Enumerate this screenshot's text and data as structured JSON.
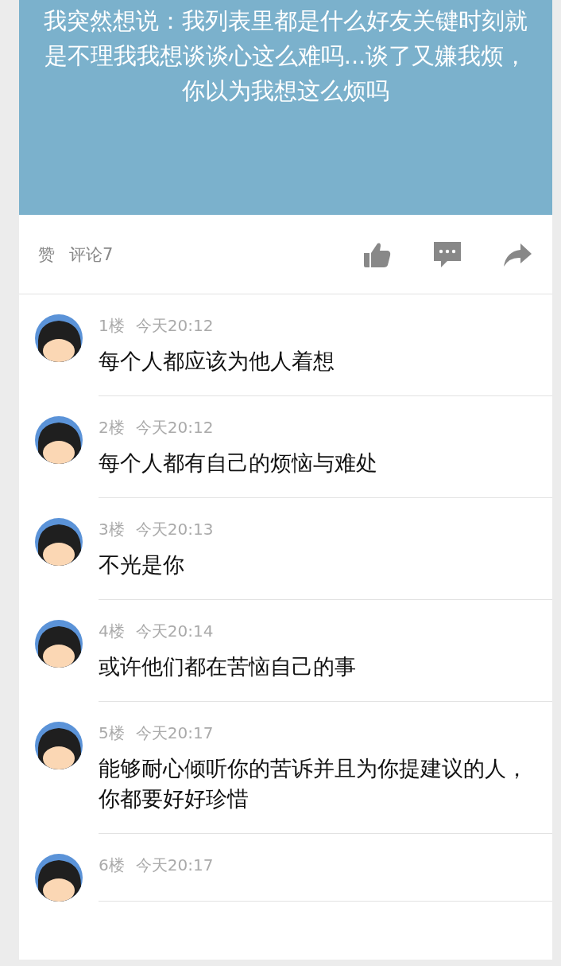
{
  "post": {
    "text": "我突然想说：我列表里都是什么好友关键时刻就是不理我我想谈谈心这么难吗...谈了又嫌我烦，你以为我想这么烦吗"
  },
  "actions": {
    "like_label": "赞",
    "comment_label": "评论7"
  },
  "comments": [
    {
      "floor": "1楼",
      "time": "今天20:12",
      "text": "每个人都应该为他人着想"
    },
    {
      "floor": "2楼",
      "time": "今天20:12",
      "text": "每个人都有自己的烦恼与难处"
    },
    {
      "floor": "3楼",
      "time": "今天20:13",
      "text": "不光是你"
    },
    {
      "floor": "4楼",
      "time": "今天20:14",
      "text": "或许他们都在苦恼自己的事"
    },
    {
      "floor": "5楼",
      "time": "今天20:17",
      "text": "能够耐心倾听你的苦诉并且为你提建议的人，你都要好好珍惜"
    },
    {
      "floor": "6楼",
      "time": "今天20:17"
    }
  ]
}
